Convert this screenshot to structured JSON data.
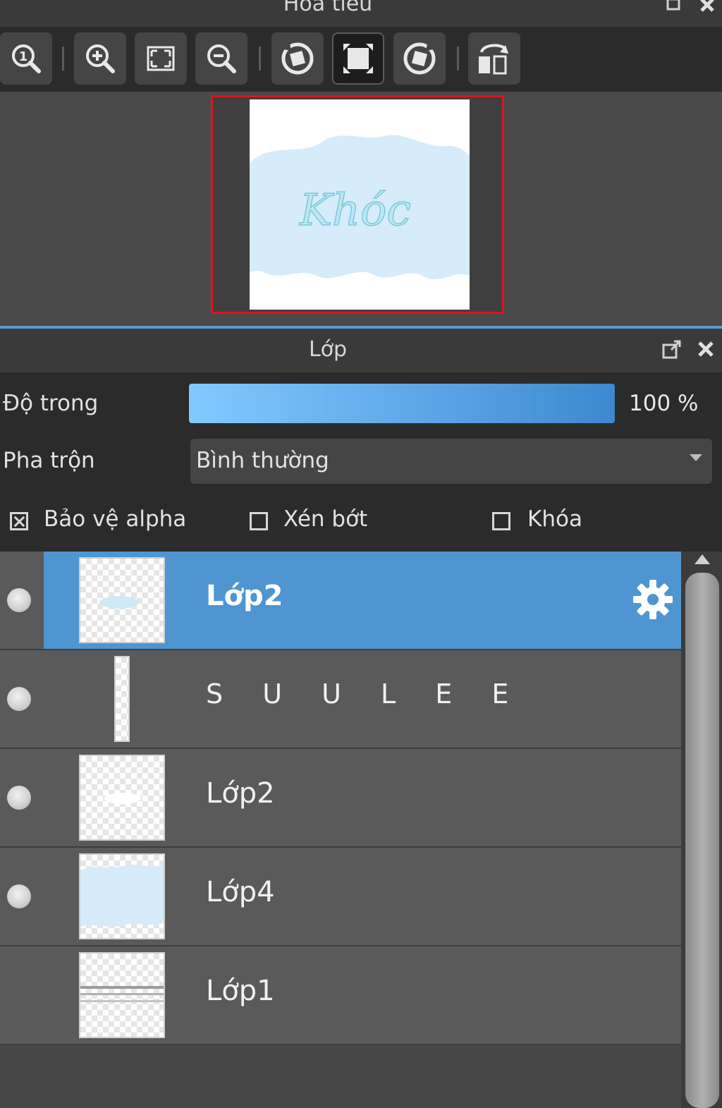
{
  "navigator": {
    "title": "Hoa tieu",
    "preview_text": "Khóc",
    "toolbar_icons": [
      "zoom-actual-icon",
      "zoom-in-icon",
      "fit-screen-icon",
      "zoom-out-icon",
      "rotate-left-icon",
      "fit-window-icon",
      "rotate-right-icon",
      "flip-icon"
    ]
  },
  "layer_panel": {
    "title": "Lớp",
    "opacity_label": "Độ trong",
    "opacity_value": "100 %",
    "opacity": 100,
    "blend_label": "Pha trộn",
    "blend_value": "Bình thường",
    "options": {
      "protect_alpha": {
        "label": "Bảo vệ alpha",
        "checked": true
      },
      "clipping": {
        "label": "Xén bớt",
        "checked": false
      },
      "lock": {
        "label": "Khóa",
        "checked": false
      }
    },
    "layers": [
      {
        "name": "Lớp2",
        "selected": true,
        "visible": true
      },
      {
        "name": "S U U L E E",
        "selected": false,
        "visible": true
      },
      {
        "name": "Lớp2",
        "selected": false,
        "visible": true
      },
      {
        "name": "Lớp4",
        "selected": false,
        "visible": true
      },
      {
        "name": "Lớp1",
        "selected": false,
        "visible": false
      }
    ]
  },
  "colors": {
    "accent": "#4f95d1",
    "preview_border": "#e0141e",
    "cloud": "#d6ecfb"
  }
}
